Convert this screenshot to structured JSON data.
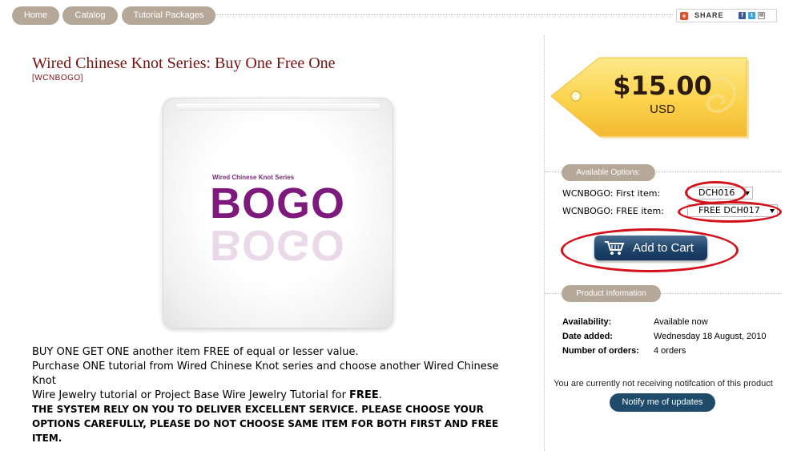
{
  "nav": {
    "items": [
      {
        "label": "Home"
      },
      {
        "label": "Catalog"
      },
      {
        "label": "Tutorial Packages"
      }
    ],
    "share_label": "SHARE"
  },
  "product": {
    "title": "Wired Chinese Knot Series: Buy One Free One",
    "sku": "[WCNBOGO]",
    "image_text_small": "Wired Chinese Knot Series",
    "image_text_big": "BOGO",
    "description_lines": [
      "BUY ONE GET ONE another item FREE of equal or lesser value.",
      "Purchase ONE tutorial from Wired Chinese Knot series and choose another Wired Chinese Knot",
      "Wire Jewelry tutorial or Project Base Wire Jewelry Tutorial for "
    ],
    "description_bold": "FREE",
    "description_end": ".",
    "warning": "THE SYSTEM RELY ON YOU TO DELIVER EXCELLENT SERVICE. PLEASE CHOOSE YOUR OPTIONS CAREFULLY, PLEASE DO NOT CHOOSE SAME ITEM FOR BOTH FIRST AND FREE ITEM."
  },
  "price": {
    "amount": "$15.00",
    "currency": "USD"
  },
  "options": {
    "header": "Available Options:",
    "first_label": "WCNBOGO: First item:",
    "first_value": "DCH016",
    "free_label": "WCNBOGO: FREE item:",
    "free_value": "FREE DCH017"
  },
  "cart": {
    "button_label": "Add to Cart"
  },
  "info": {
    "header": "Product Information",
    "rows": [
      {
        "key": "Availability:",
        "value": "Available now"
      },
      {
        "key": "Date added:",
        "value": "Wednesday 18 August, 2010"
      },
      {
        "key": "Number of orders:",
        "value": "4 orders"
      }
    ]
  },
  "notification": {
    "text": "You are currently not receiving notifcation of this product",
    "button_label": "Notify me of updates"
  },
  "colors": {
    "nav_pill": "#b5a898",
    "title": "#7a1212",
    "tag": "#fcd95a",
    "cart_button": "#20456b",
    "annotation_ring": "#d4121c"
  }
}
